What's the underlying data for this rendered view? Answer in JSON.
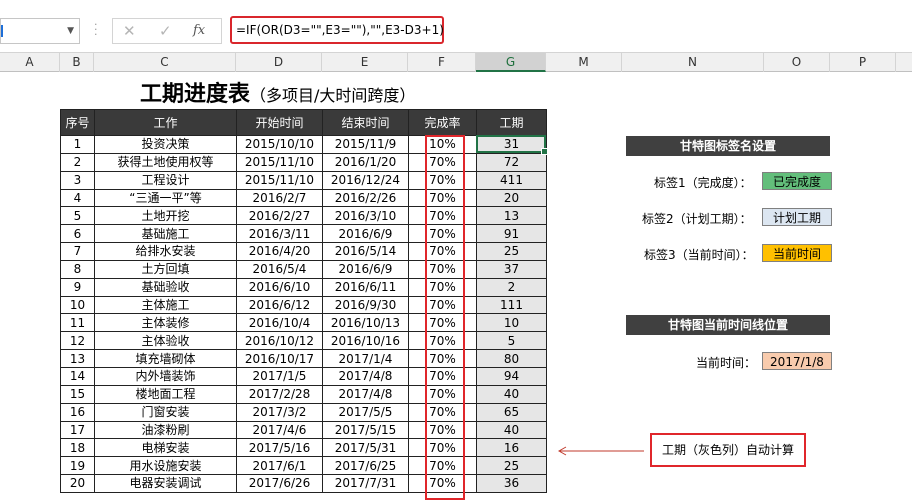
{
  "formula_bar": {
    "fx_label": "fx",
    "cancel_icon": "✕",
    "confirm_icon": "✓",
    "formula": "=IF(OR(D3=\"\",E3=\"\"),\"\",E3-D3+1)"
  },
  "columns": [
    "A",
    "B",
    "C",
    "D",
    "E",
    "F",
    "G",
    "M",
    "N",
    "O",
    "P"
  ],
  "title": {
    "main": "工期进度表",
    "sub": "（多项目/大时间跨度）"
  },
  "table": {
    "headers": [
      "序号",
      "工作",
      "开始时间",
      "结束时间",
      "完成率",
      "工期"
    ],
    "rows": [
      [
        "1",
        "投资决策",
        "2015/10/10",
        "2015/11/9",
        "10%",
        "31"
      ],
      [
        "2",
        "获得土地使用权等",
        "2015/11/10",
        "2016/1/20",
        "70%",
        "72"
      ],
      [
        "3",
        "工程设计",
        "2015/11/10",
        "2016/12/24",
        "70%",
        "411"
      ],
      [
        "4",
        "“三通一平”等",
        "2016/2/7",
        "2016/2/26",
        "70%",
        "20"
      ],
      [
        "5",
        "土地开挖",
        "2016/2/27",
        "2016/3/10",
        "70%",
        "13"
      ],
      [
        "6",
        "基础施工",
        "2016/3/11",
        "2016/6/9",
        "70%",
        "91"
      ],
      [
        "7",
        "给排水安装",
        "2016/4/20",
        "2016/5/14",
        "70%",
        "25"
      ],
      [
        "8",
        "土方回填",
        "2016/5/4",
        "2016/6/9",
        "70%",
        "37"
      ],
      [
        "9",
        "基础验收",
        "2016/6/10",
        "2016/6/11",
        "70%",
        "2"
      ],
      [
        "10",
        "主体施工",
        "2016/6/12",
        "2016/9/30",
        "70%",
        "111"
      ],
      [
        "11",
        "主体装修",
        "2016/10/4",
        "2016/10/13",
        "70%",
        "10"
      ],
      [
        "12",
        "主体验收",
        "2016/10/12",
        "2016/10/16",
        "70%",
        "5"
      ],
      [
        "13",
        "填充墙砌体",
        "2016/10/17",
        "2017/1/4",
        "70%",
        "80"
      ],
      [
        "14",
        "内外墙装饰",
        "2017/1/5",
        "2017/4/8",
        "70%",
        "94"
      ],
      [
        "15",
        "楼地面工程",
        "2017/2/28",
        "2017/4/8",
        "70%",
        "40"
      ],
      [
        "16",
        "门窗安装",
        "2017/3/2",
        "2017/5/5",
        "70%",
        "65"
      ],
      [
        "17",
        "油漆粉刷",
        "2017/4/6",
        "2017/5/15",
        "70%",
        "40"
      ],
      [
        "18",
        "电梯安装",
        "2017/5/16",
        "2017/5/31",
        "70%",
        "16"
      ],
      [
        "19",
        "用水设施安装",
        "2017/6/1",
        "2017/6/25",
        "70%",
        "25"
      ],
      [
        "20",
        "电器安装调试",
        "2017/6/26",
        "2017/7/31",
        "70%",
        "36"
      ]
    ]
  },
  "panel": {
    "label_settings_title": "甘特图标签名设置",
    "tag1_label": "标签1（完成度）：",
    "tag1_value": "已完成度",
    "tag2_label": "标签2（计划工期）：",
    "tag2_value": "计划工期",
    "tag3_label": "标签3（当前时间）：",
    "tag3_value": "当前时间",
    "timeline_title": "甘特图当前时间线位置",
    "current_time_label": "当前时间：",
    "current_time_value": "2017/1/8",
    "colors": {
      "tag1": "#63be7b",
      "tag2": "#dce6f1",
      "tag3": "#ffc000",
      "current_time": "#f8cbad"
    }
  },
  "callout": "工期（灰色列）自动计算"
}
